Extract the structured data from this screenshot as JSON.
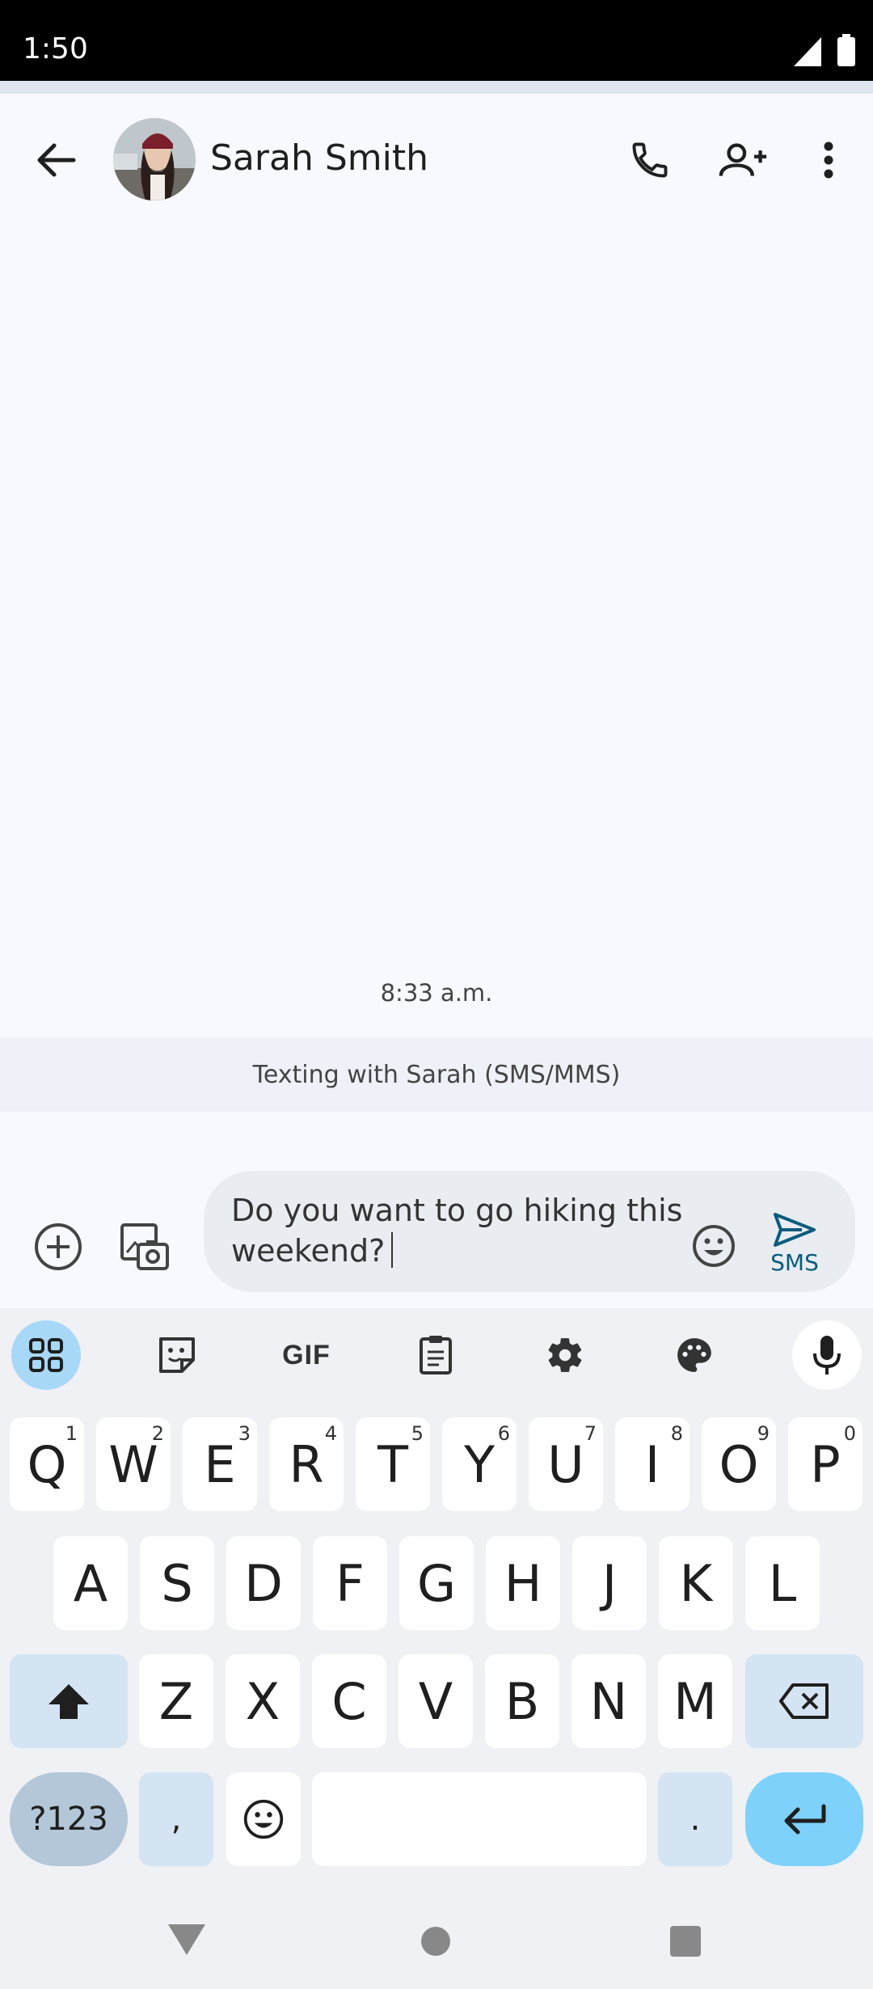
{
  "status_bar": {
    "time": "1:50"
  },
  "app_bar": {
    "contact_name": "Sarah Smith",
    "icons": [
      "back-arrow-icon",
      "avatar",
      "phone-icon",
      "add-person-icon",
      "more-vert-icon"
    ]
  },
  "conversation": {
    "timestamp": "8:33 a.m.",
    "info_banner": "Texting with Sarah (SMS/MMS)"
  },
  "compose": {
    "text_line1": "Do you want to go hiking this",
    "text_line2": "weekend?",
    "send_label": "SMS"
  },
  "keyboard": {
    "toolbar": {
      "gif_label": "GIF"
    },
    "row1": [
      {
        "key": "Q",
        "hint": "1"
      },
      {
        "key": "W",
        "hint": "2"
      },
      {
        "key": "E",
        "hint": "3"
      },
      {
        "key": "R",
        "hint": "4"
      },
      {
        "key": "T",
        "hint": "5"
      },
      {
        "key": "Y",
        "hint": "6"
      },
      {
        "key": "U",
        "hint": "7"
      },
      {
        "key": "I",
        "hint": "8"
      },
      {
        "key": "O",
        "hint": "9"
      },
      {
        "key": "P",
        "hint": "0"
      }
    ],
    "row2": [
      "A",
      "S",
      "D",
      "F",
      "G",
      "H",
      "J",
      "K",
      "L"
    ],
    "row3": [
      "Z",
      "X",
      "C",
      "V",
      "B",
      "N",
      "M"
    ],
    "symbols_label": "?123",
    "comma_label": ",",
    "period_label": "."
  },
  "colors": {
    "accent": "#0b5c7d",
    "keyboard_bg": "#eff1f4",
    "enter_key": "#7ed1fb",
    "function_key": "#d4e4f3"
  }
}
